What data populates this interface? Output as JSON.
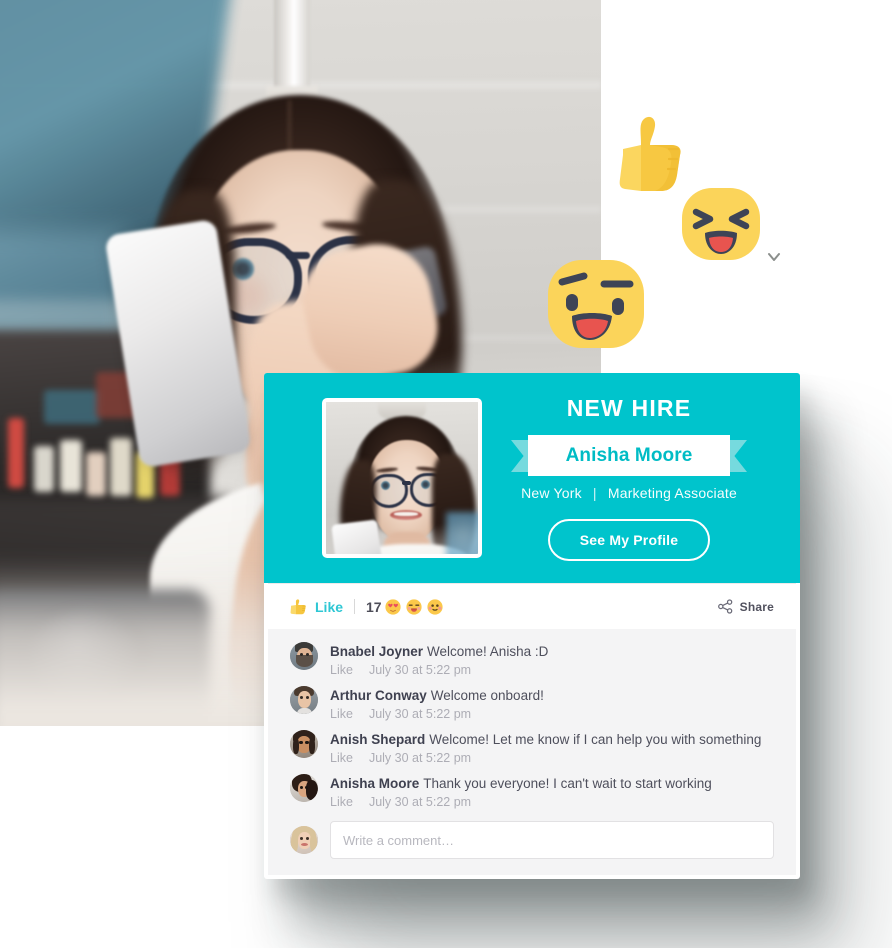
{
  "card": {
    "banner": {
      "title": "NEW HIRE",
      "name": "Anisha Moore",
      "location": "New York",
      "separator": "|",
      "role": "Marketing Associate",
      "profile_button": "See My Profile",
      "photo_alt": "anisha-moore-headshot",
      "accent_color": "#00c4cc",
      "ribbon_tail_color": "#76dade",
      "name_color": "#00bcc5"
    },
    "reactions": {
      "thumb_icon": "thumbs-up-icon",
      "like_label": "Like",
      "count": "17",
      "emojis": [
        "heart-eyes-emoji",
        "tongue-out-emoji",
        "blushing-emoji"
      ],
      "share_icon": "share-icon",
      "share_label": "Share",
      "like_color": "#2ec7d4"
    },
    "comments": [
      {
        "author": "Bnabel Joyner",
        "text": "Welcome! Anisha :D",
        "like_label": "Like",
        "timestamp": "July 30 at 5:22 pm",
        "avatar": "avatar-bnabel-joyner"
      },
      {
        "author": "Arthur Conway",
        "text": "Welcome onboard!",
        "like_label": "Like",
        "timestamp": "July 30 at 5:22 pm",
        "avatar": "avatar-arthur-conway"
      },
      {
        "author": "Anish Shepard",
        "text": "Welcome! Let me know if I can help you with something",
        "like_label": "Like",
        "timestamp": "July 30 at 5:22 pm",
        "avatar": "avatar-anish-shepard"
      },
      {
        "author": "Anisha Moore",
        "text": "Thank you everyone! I can't wait to start working",
        "like_label": "Like",
        "timestamp": "July 30 at 5:22 pm",
        "avatar": "avatar-anisha-moore"
      }
    ],
    "composer": {
      "placeholder": "Write a comment…",
      "value": "",
      "avatar": "avatar-current-user"
    }
  },
  "decor": {
    "emojis": [
      {
        "name": "thumbs-up-emoji"
      },
      {
        "name": "laughing-emoji"
      },
      {
        "name": "smirking-emoji"
      }
    ],
    "chevron": "chevron-down-icon"
  },
  "hero": {
    "photo_alt": "woman-with-glasses-holding-phone"
  }
}
